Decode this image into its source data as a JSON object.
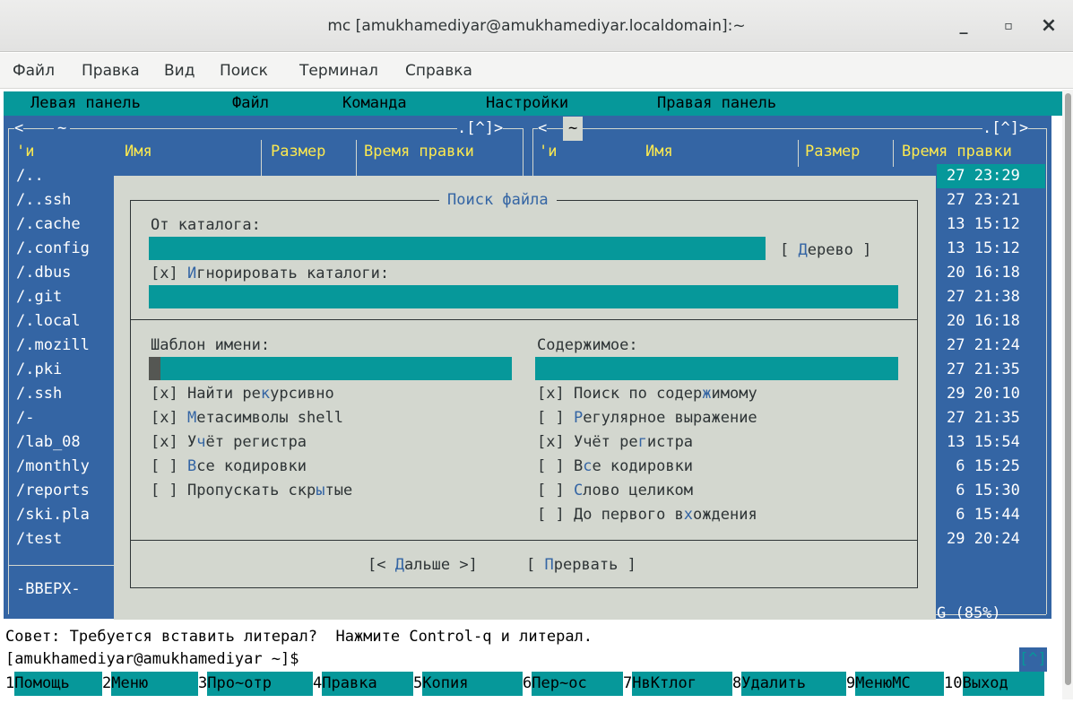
{
  "window": {
    "title": "mc [amukhamediyar@amukhamediyar.localdomain]:~",
    "minimize_glyph": "_",
    "maximize_glyph": "▫",
    "close_glyph": "×"
  },
  "gnome_menu": [
    "Файл",
    "Правка",
    "Вид",
    "Поиск",
    "Терминал",
    "Справка"
  ],
  "mc_menu": [
    "Левая панель",
    "Файл",
    "Команда",
    "Настройки",
    "Правая панель"
  ],
  "left_panel": {
    "path": "~",
    "hotlist": ".[^]>",
    "nav": "<",
    "col_mark": "'и",
    "col_name": "Имя",
    "col_size": "Размер",
    "col_time": "Время правки",
    "items": [
      "/..",
      "/..ssh",
      "/.cache",
      "/.config",
      "/.dbus",
      "/.git",
      "/.local",
      "/.mozill",
      "/.pki",
      "/.ssh",
      "/-",
      "/lab_08",
      "/monthly",
      "/reports",
      "/ski.pla",
      "/test"
    ],
    "status": "-ВВЕРХ-"
  },
  "right_panel": {
    "path": "~",
    "hotlist": ".[^]>",
    "nav": "<",
    "col_mark": "'и",
    "col_name": "Имя",
    "col_size": "Размер",
    "col_time": "Время правки",
    "times": [
      "27 23:29",
      "27 23:21",
      "13 15:12",
      "13 15:12",
      "20 16:18",
      "27 21:38",
      "20 16:18",
      "27 21:24",
      "27 21:35",
      "29 20:10",
      "27 21:35",
      "13 15:54",
      " 6 15:25",
      " 6 15:30",
      " 6 15:44",
      "29 20:24"
    ],
    "disk": "G (85%)"
  },
  "dialog": {
    "title": "Поиск файла",
    "start_label": "От каталога:",
    "start_value": "",
    "tree_button": {
      "open": "[ ",
      "hot": "Д",
      "rest": "ерево",
      "close": " ]"
    },
    "ignore": {
      "box": "[x] ",
      "hot": "И",
      "rest": "гнорировать каталоги:"
    },
    "ignore_value": "",
    "name_label": "Шаблон имени:",
    "content_label": "Содержимое:",
    "name_value": "",
    "content_value": "",
    "left_opts": [
      {
        "box": "[x] ",
        "pre": "Найти ре",
        "hot": "к",
        "post": "урсивно"
      },
      {
        "box": "[x] ",
        "pre": "",
        "hot": "М",
        "post": "етасимволы shell"
      },
      {
        "box": "[x] ",
        "pre": "У",
        "hot": "ч",
        "post": "ёт регистра"
      },
      {
        "box": "[ ] ",
        "pre": "",
        "hot": "В",
        "post": "се кодировки"
      },
      {
        "box": "[ ] ",
        "pre": "Пропускать скр",
        "hot": "ы",
        "post": "тые"
      }
    ],
    "right_opts": [
      {
        "box": "[x] ",
        "pre": "Поиск по содер",
        "hot": "ж",
        "post": "имому"
      },
      {
        "box": "[ ] ",
        "pre": "",
        "hot": "Р",
        "post": "егулярное выражение"
      },
      {
        "box": "[x] ",
        "pre": "Учёт ре",
        "hot": "г",
        "post": "истра"
      },
      {
        "box": "[ ] ",
        "pre": "В",
        "hot": "с",
        "post": "е кодировки"
      },
      {
        "box": "[ ] ",
        "pre": "",
        "hot": "С",
        "post": "лово целиком"
      },
      {
        "box": "[ ] ",
        "pre": "До первого в",
        "hot": "х",
        "post": "ождения"
      }
    ],
    "ok_button": {
      "open": "[< ",
      "hot": "Д",
      "rest": "альше",
      "close": " >]"
    },
    "cancel_button": {
      "open": "[ ",
      "hot": "П",
      "rest": "рервать",
      "close": " ]"
    }
  },
  "hint": "Совет: Требуется вставить литерал?  Нажмите Control-q и литерал.",
  "prompt": "[amukhamediyar@amukhamediyar ~]$",
  "prompt_hotlist": "[^]",
  "fkeys": [
    {
      "num": "1",
      "label": "Помощь"
    },
    {
      "num": "2",
      "label": "Меню"
    },
    {
      "num": "3",
      "label": "Про~отр"
    },
    {
      "num": "4",
      "label": "Правка"
    },
    {
      "num": "5",
      "label": "Копия"
    },
    {
      "num": "6",
      "label": "Пер~ос"
    },
    {
      "num": "7",
      "label": "НвКтлог"
    },
    {
      "num": "8",
      "label": "Удалить"
    },
    {
      "num": "9",
      "label": "МенюMC"
    },
    {
      "num": "10",
      "label": "Выход"
    }
  ],
  "colors": {
    "panel_bg": "#3465a4",
    "menu_bg": "#06989a",
    "dialog_bg": "#d3d7cf",
    "selected_bg": "#06989a",
    "input_bg": "#06989a"
  }
}
